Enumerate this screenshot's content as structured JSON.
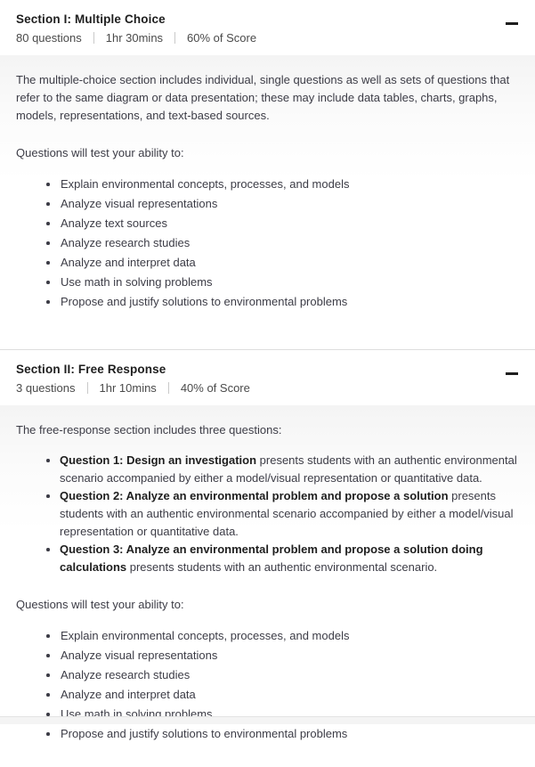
{
  "colors": {
    "panel_bg": "#f4f4f4",
    "text": "#3c3c46",
    "heading": "#1e1e1e",
    "divider": "#dddddd",
    "bullet": "#3c3c46"
  },
  "sections": [
    {
      "id": "section-1",
      "title": "Section I: Multiple Choice",
      "meta": {
        "questions": "80 questions",
        "duration": "1hr 30mins",
        "weight": "60% of Score"
      },
      "toggle": {
        "icon": "minus-icon",
        "state": "expanded"
      },
      "body": {
        "intro": "The multiple-choice section includes individual, single questions as well as sets of questions that refer to the same diagram or data presentation; these may include data tables, charts, graphs, models, representations, and text-based sources.",
        "ability_lead": "Questions will test your ability to:",
        "abilities": [
          "Explain environmental concepts, processes, and models",
          "Analyze visual representations",
          "Analyze text sources",
          "Analyze research studies",
          "Analyze and interpret data",
          "Use math in solving problems",
          "Propose and justify solutions to environmental problems"
        ]
      }
    },
    {
      "id": "section-2",
      "title": "Section II: Free Response",
      "meta": {
        "questions": "3 questions",
        "duration": "1hr 10mins",
        "weight": "40% of Score"
      },
      "toggle": {
        "icon": "minus-icon",
        "state": "expanded"
      },
      "body": {
        "intro": "The free-response section includes three questions:",
        "questions": [
          {
            "bold": "Question 1: Design an investigation",
            "rest": " presents students with an authentic environmental scenario accompanied by either a model/visual representation or quantitative data."
          },
          {
            "bold": "Question 2: Analyze an environmental problem and propose a solution",
            "rest": " presents students with an authentic environmental scenario accompanied by either a model/visual representation or quantitative data."
          },
          {
            "bold": "Question 3: Analyze an environmental problem and propose a solution doing calculations",
            "rest": " presents students with an authentic environmental scenario."
          }
        ],
        "ability_lead": "Questions will test your ability to:",
        "abilities": [
          "Explain environmental concepts, processes, and models",
          "Analyze visual representations",
          "Analyze research studies",
          "Analyze and interpret data",
          "Use math in solving problems",
          "Propose and justify solutions to environmental problems"
        ]
      }
    }
  ]
}
